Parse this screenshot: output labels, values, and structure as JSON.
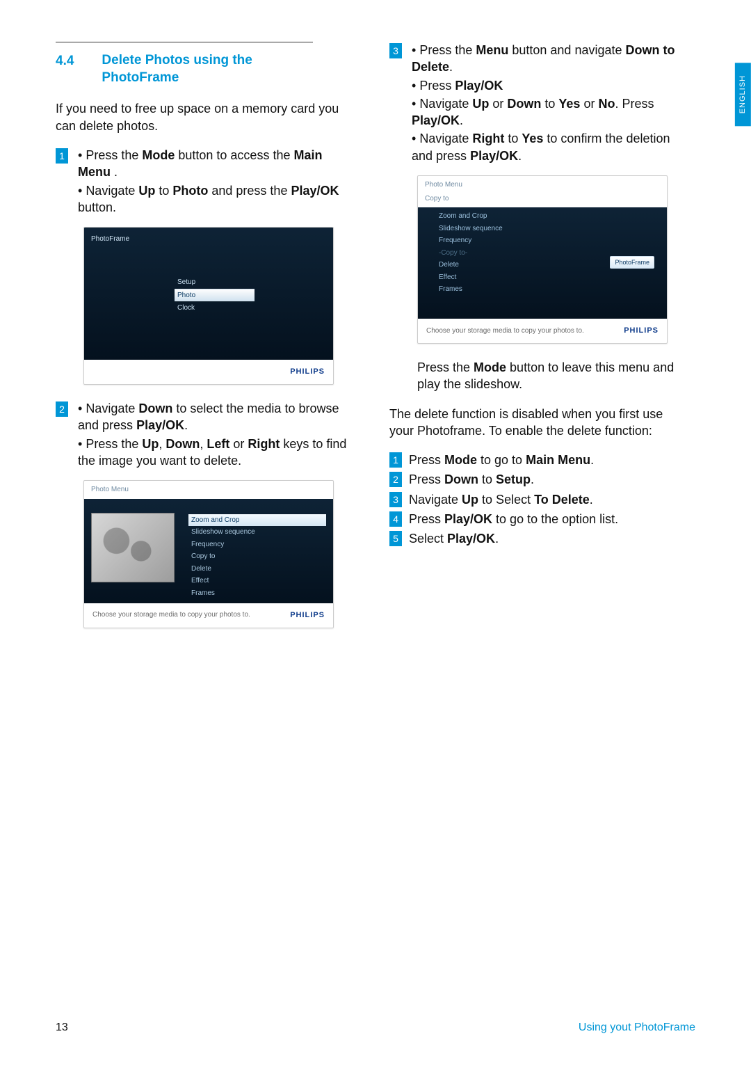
{
  "side_tab": "ENGLISH",
  "section": {
    "num": "4.4",
    "title_l1": "Delete Photos using the",
    "title_l2": "PhotoFrame"
  },
  "intro": "If you need to free up space on a memory card you can delete photos.",
  "step1": {
    "num": "1",
    "b1_pre": "Press the ",
    "b1_bold1": "Mode",
    "b1_mid": " button to access the ",
    "b1_bold2": "Main Menu",
    "b1_post": " .",
    "b2_pre": "Navigate ",
    "b2_bold1": "Up",
    "b2_mid": " to ",
    "b2_bold2": "Photo",
    "b2_mid2": " and press the ",
    "b2_bold3": "Play/OK",
    "b2_post": " button."
  },
  "shot1": {
    "label": "PhotoFrame",
    "m_setup": "Setup",
    "m_photo": "Photo",
    "m_clock": "Clock",
    "brand": "PHILIPS"
  },
  "step2": {
    "num": "2",
    "b1_pre": "Navigate ",
    "b1_bold1": "Down",
    "b1_mid": " to select the media to browse and press ",
    "b1_bold2": "Play/OK",
    "b1_post": ".",
    "b2_pre": "Press the ",
    "b2_bold1": "Up",
    "b2_c1": ", ",
    "b2_bold2": "Down",
    "b2_c2": ", ",
    "b2_bold3": "Left",
    "b2_mid": " or ",
    "b2_bold4": "Right",
    "b2_post": " keys to find the image you want to delete."
  },
  "shot2": {
    "hdr": "Photo Menu",
    "m_zoom": "Zoom and Crop",
    "m_slide": "Slideshow sequence",
    "m_freq": "Frequency",
    "m_copy": "Copy to",
    "m_delete": "Delete",
    "m_effect": "Effect",
    "m_frames": "Frames",
    "caption": "Choose your storage media to copy your photos to.",
    "brand": "PHILIPS"
  },
  "step3": {
    "num": "3",
    "b1_pre": "Press the ",
    "b1_bold1": "Menu",
    "b1_mid": " button and navigate ",
    "b1_bold2": "Down to Delete",
    "b1_post": ".",
    "b2_pre": "Press ",
    "b2_bold1": "Play/OK",
    "b3_pre": "Navigate ",
    "b3_bold1": "Up",
    "b3_mid": " or ",
    "b3_bold2": "Down",
    "b3_mid2": " to ",
    "b3_bold3": "Yes",
    "b3_mid3": " or ",
    "b3_bold4": "No",
    "b3_mid4": ". Press ",
    "b3_bold5": "Play/OK",
    "b3_post": ".",
    "b4_pre": "Navigate ",
    "b4_bold1": "Right",
    "b4_mid": " to ",
    "b4_bold2": "Yes",
    "b4_mid2": " to confirm the deletion and press ",
    "b4_bold3": "Play/OK",
    "b4_post": "."
  },
  "shot3": {
    "hdr": "Photo Menu",
    "sub": "Copy to",
    "m_zoom": "Zoom and Crop",
    "m_slide": "Slideshow sequence",
    "m_freq": "Frequency",
    "m_copy": "-Copy to-",
    "m_delete": "Delete",
    "m_effect": "Effect",
    "m_frames": "Frames",
    "pill": "PhotoFrame",
    "caption": "Choose your storage media to copy your photos to.",
    "brand": "PHILIPS"
  },
  "after3_pre": "Press the ",
  "after3_bold": "Mode",
  "after3_post": " button to leave this menu and play the slideshow.",
  "enable_intro": "The delete function is disabled when you first use your Photoframe. To enable the delete function:",
  "en1": {
    "n": "1",
    "pre": "Press ",
    "b1": "Mode",
    "mid": " to go to ",
    "b2": "Main Menu",
    "post": "."
  },
  "en2": {
    "n": "2",
    "pre": "Press ",
    "b1": "Down",
    "mid": " to ",
    "b2": "Setup",
    "post": "."
  },
  "en3": {
    "n": "3",
    "pre": "Navigate ",
    "b1": "Up",
    "mid": " to Select ",
    "b2": "To Delete",
    "post": "."
  },
  "en4": {
    "n": "4",
    "pre": "Press ",
    "b1": "Play/OK",
    "post": " to go to the option list."
  },
  "en5": {
    "n": "5",
    "pre": "Select ",
    "b1": "Play/OK",
    "post": "."
  },
  "footer": {
    "page": "13",
    "title": "Using yout PhotoFrame"
  }
}
